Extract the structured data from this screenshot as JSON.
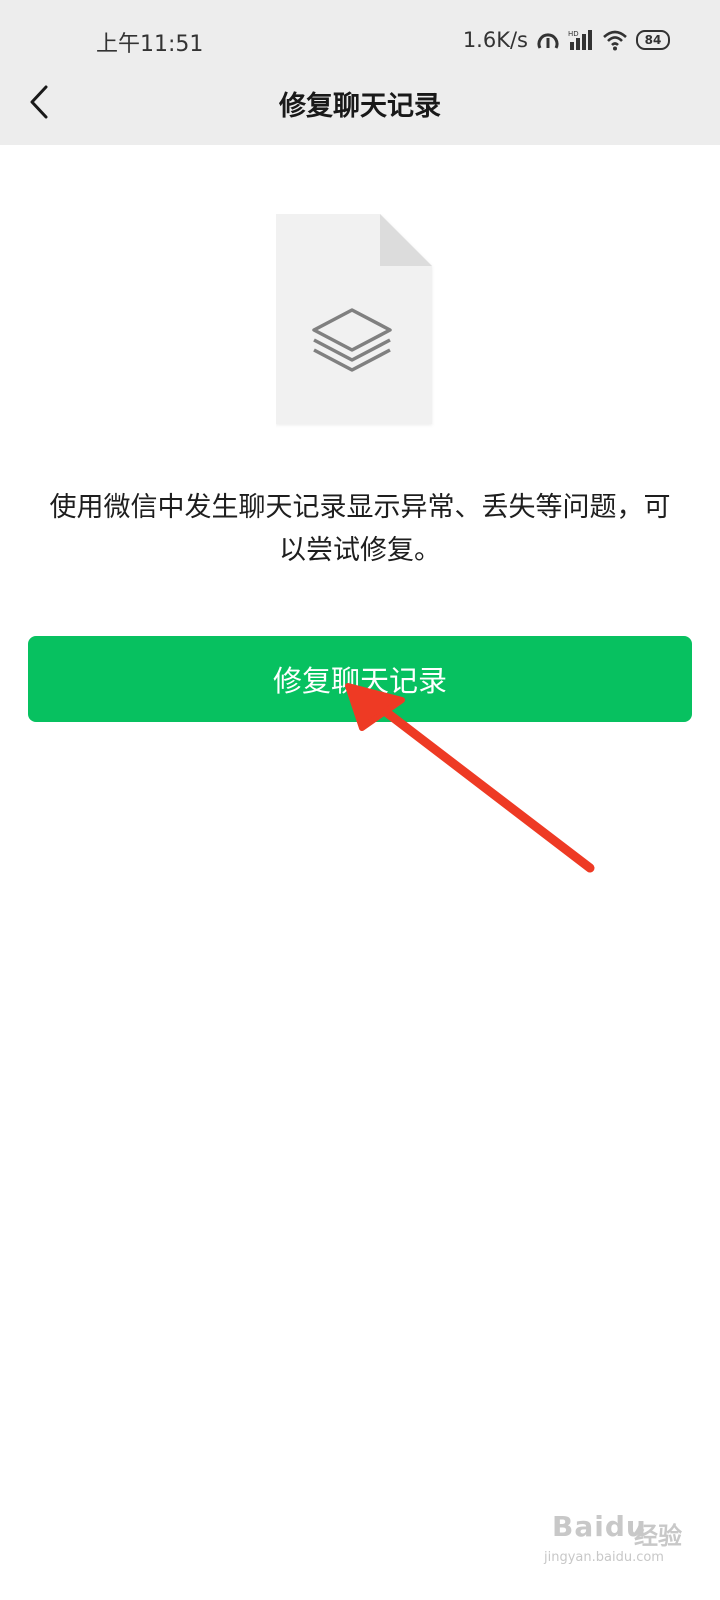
{
  "status_bar": {
    "time": "上午11:51",
    "net_speed": "1.6K/s",
    "battery": "84",
    "icons": [
      "hotspot-icon",
      "signal-icon",
      "wifi-icon",
      "battery-icon"
    ]
  },
  "nav": {
    "back_icon": "chevron-left-icon",
    "title": "修复聊天记录"
  },
  "main": {
    "illustration_icon": "layers-icon",
    "description": "使用微信中发生聊天记录显示异常、丢失等问题，可以尝试修复。",
    "button_label": "修复聊天记录"
  },
  "watermark": {
    "logo": "Baidu",
    "label": "经验",
    "url": "jingyan.baidu.com"
  },
  "colors": {
    "accent": "#07c160",
    "arrow": "#ee3a24",
    "topbar_bg": "#ededed"
  }
}
